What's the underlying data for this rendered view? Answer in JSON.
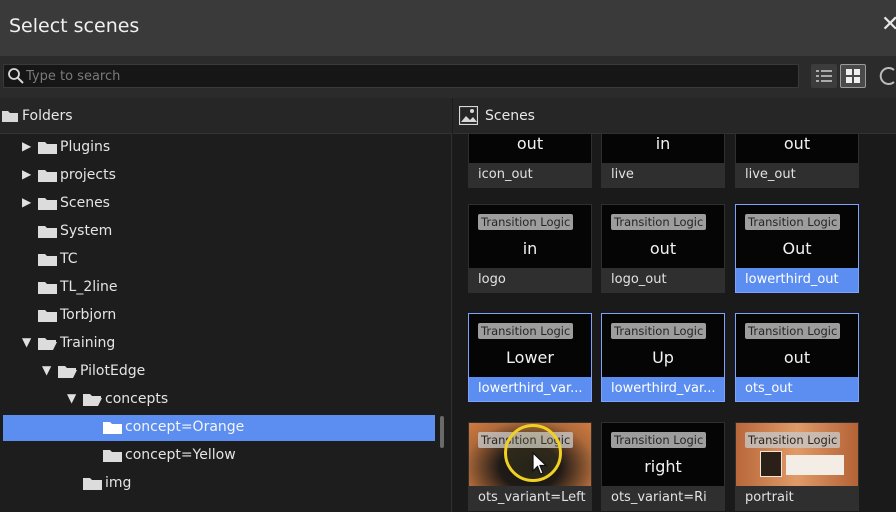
{
  "window": {
    "title": "Select scenes",
    "close_glyph": "✕"
  },
  "search": {
    "placeholder": "Type to search",
    "value": ""
  },
  "view": {
    "active": "grid"
  },
  "folders_panel": {
    "header": "Folders",
    "items": [
      {
        "label": "Plugins",
        "level": 1,
        "arrow": "collapsed",
        "selected": false
      },
      {
        "label": "projects",
        "level": 1,
        "arrow": "collapsed",
        "selected": false
      },
      {
        "label": "Scenes",
        "level": 1,
        "arrow": "collapsed",
        "selected": false
      },
      {
        "label": "System",
        "level": 1,
        "arrow": "none",
        "selected": false
      },
      {
        "label": "TC",
        "level": 1,
        "arrow": "none",
        "selected": false
      },
      {
        "label": "TL_2line",
        "level": 1,
        "arrow": "none",
        "selected": false
      },
      {
        "label": "Torbjorn",
        "level": 1,
        "arrow": "none",
        "selected": false
      },
      {
        "label": "Training",
        "level": 1,
        "arrow": "expanded",
        "selected": false
      },
      {
        "label": "PilotEdge",
        "level": 2,
        "arrow": "expanded",
        "selected": false
      },
      {
        "label": "concepts",
        "level": 3,
        "arrow": "expanded",
        "selected": false
      },
      {
        "label": "concept=Orange",
        "level": 4,
        "arrow": "none",
        "selected": true
      },
      {
        "label": "concept=Yellow",
        "level": 4,
        "arrow": "none",
        "selected": false
      },
      {
        "label": "img",
        "level": 3,
        "arrow": "none",
        "selected": false
      }
    ]
  },
  "scenes_panel": {
    "header": "Scenes",
    "badge": "Transition Logic",
    "rows": [
      [
        {
          "name": "icon_out",
          "thumb_text": "out",
          "badge": false,
          "selected": false,
          "style": "dark"
        },
        {
          "name": "live",
          "thumb_text": "in",
          "badge": false,
          "selected": false,
          "style": "dark"
        },
        {
          "name": "live_out",
          "thumb_text": "out",
          "badge": false,
          "selected": false,
          "style": "dark"
        }
      ],
      [
        {
          "name": "logo",
          "thumb_text": "in",
          "badge": true,
          "selected": false,
          "style": "dark"
        },
        {
          "name": "logo_out",
          "thumb_text": "out",
          "badge": true,
          "selected": false,
          "style": "dark"
        },
        {
          "name": "lowerthird_out",
          "thumb_text": "Out",
          "badge": true,
          "selected": true,
          "style": "dark"
        }
      ],
      [
        {
          "name": "lowerthird_var...",
          "thumb_text": "Lower",
          "badge": true,
          "selected": true,
          "style": "dark"
        },
        {
          "name": "lowerthird_var...",
          "thumb_text": "Up",
          "badge": true,
          "selected": true,
          "style": "dark"
        },
        {
          "name": "ots_out",
          "thumb_text": "out",
          "badge": true,
          "selected": true,
          "style": "dark"
        }
      ],
      [
        {
          "name": "ots_variant=Left",
          "thumb_text": "",
          "badge": true,
          "selected": false,
          "style": "orange"
        },
        {
          "name": "ots_variant=Ri",
          "thumb_text": "right",
          "badge": true,
          "selected": false,
          "style": "dark"
        },
        {
          "name": "portrait",
          "thumb_text": "",
          "badge": true,
          "selected": false,
          "style": "portrait"
        }
      ]
    ]
  },
  "colors": {
    "selection": "#5b8ef0",
    "highlight_ring": "#f0d020",
    "selected_border": "#7ea2ff"
  }
}
